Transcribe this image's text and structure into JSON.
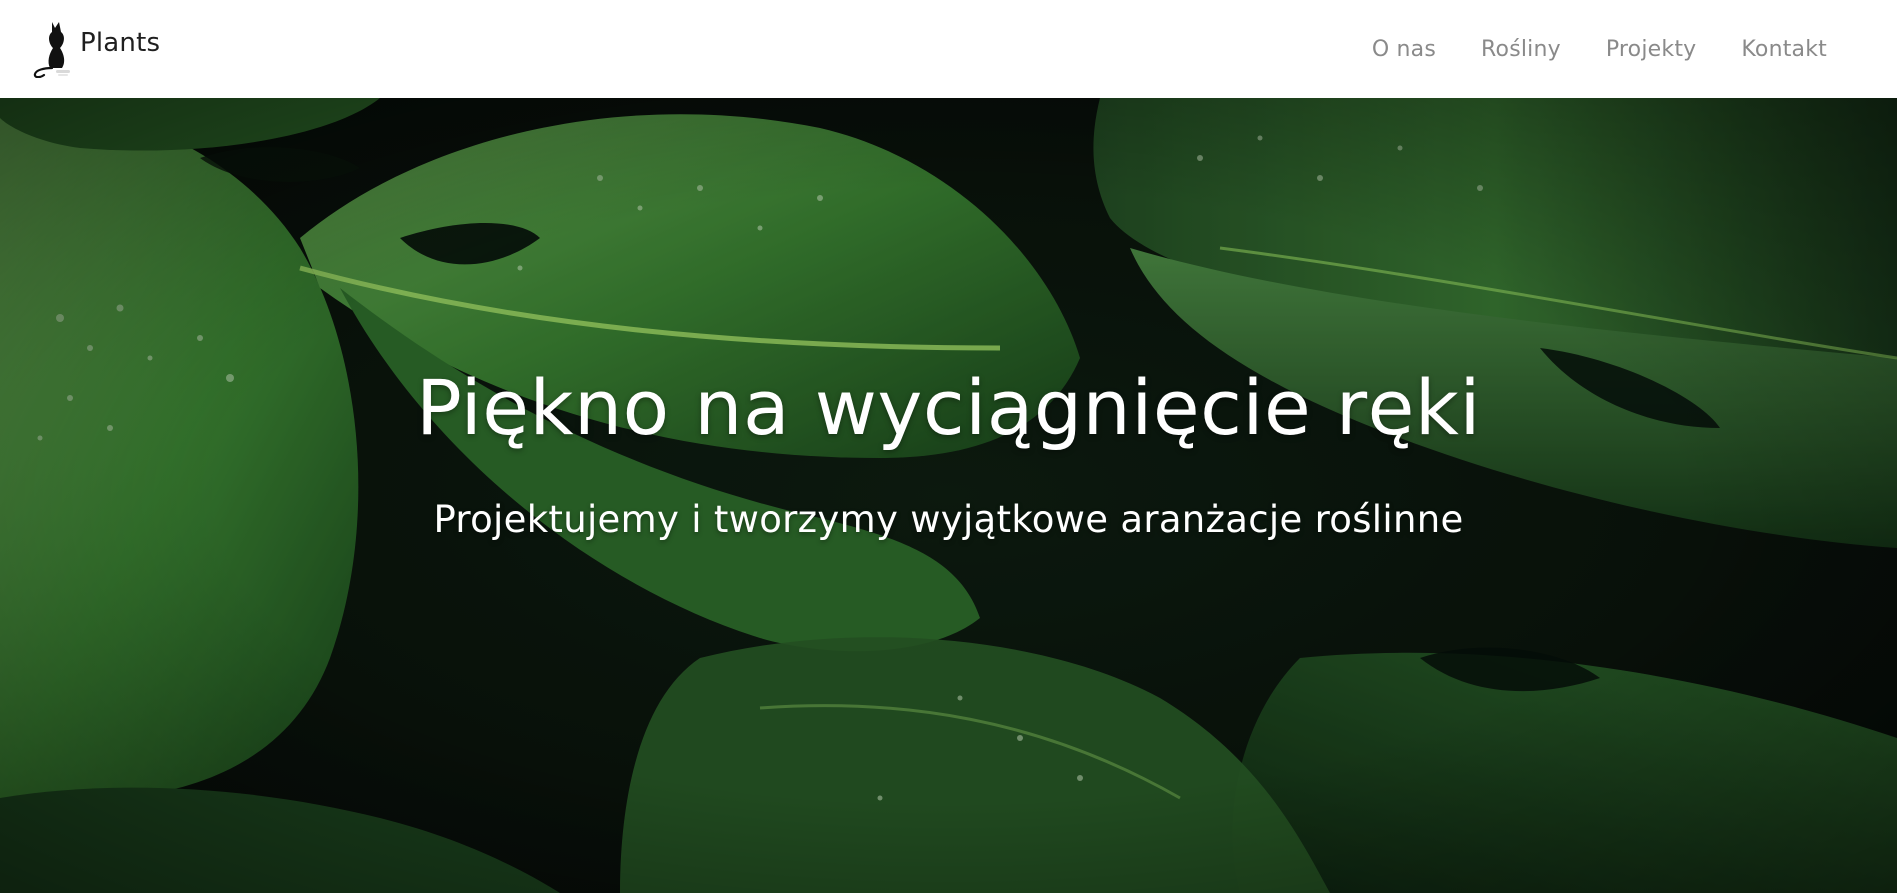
{
  "brand": {
    "name": "Plants",
    "logo_icon": "cat-silhouette-logo"
  },
  "nav": {
    "items": [
      {
        "label": "O nas"
      },
      {
        "label": "Rośliny"
      },
      {
        "label": "Projekty"
      },
      {
        "label": "Kontakt"
      }
    ]
  },
  "hero": {
    "title": "Piękno na wyciągnięcie ręki",
    "subtitle": "Projektujemy i tworzymy wyjątkowe aranżacje roślinne",
    "background": "monstera-leaves-photo"
  },
  "colors": {
    "navbar_bg": "#ffffff",
    "nav_link": "#8a8a8a",
    "brand_text": "#1f1f1f",
    "hero_text": "#ffffff",
    "leaf_dark": "#1d4a22",
    "leaf_light": "#5fa83a"
  }
}
